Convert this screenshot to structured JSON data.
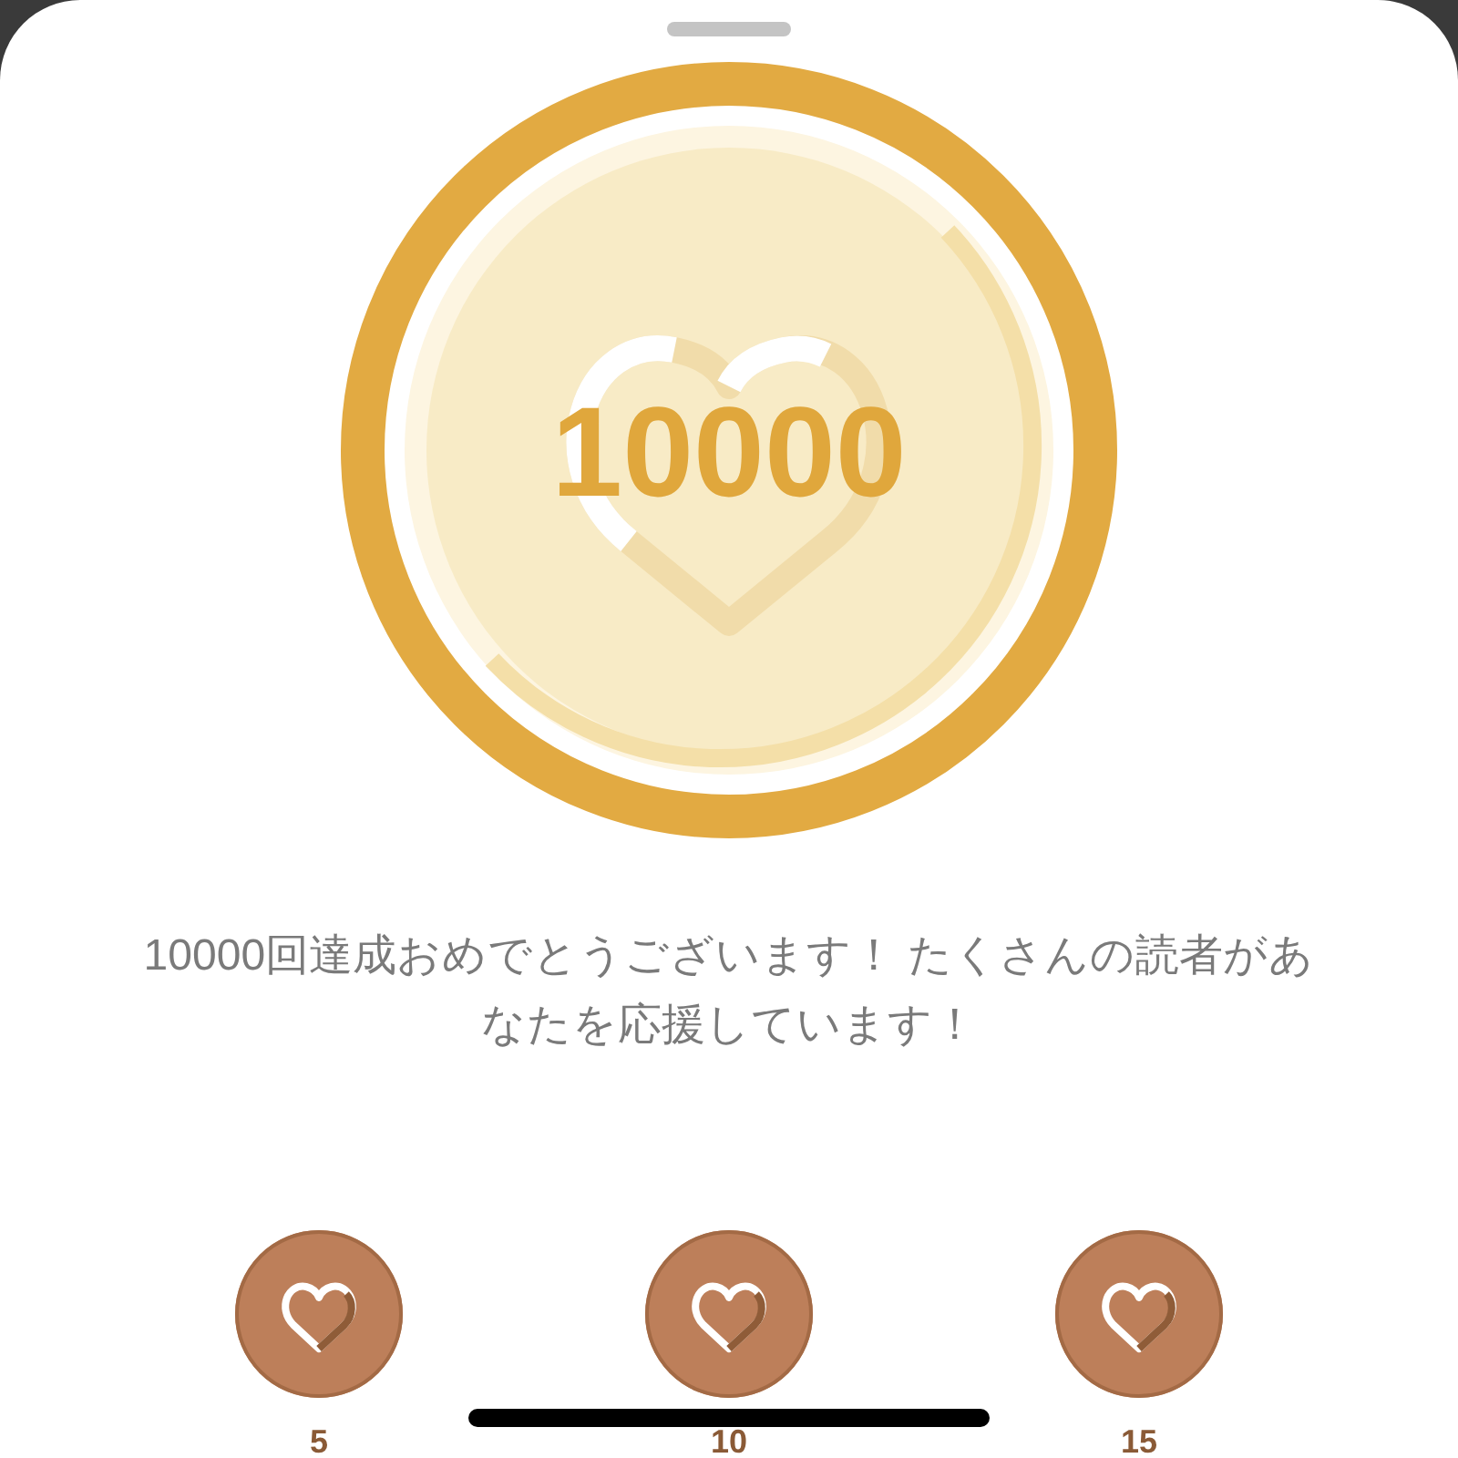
{
  "medal": {
    "count": "10000"
  },
  "message": "10000回達成おめでとうございます！ たくさんの読者があなたを応援しています！",
  "badges": [
    {
      "label": "5"
    },
    {
      "label": "10"
    },
    {
      "label": "15"
    }
  ]
}
